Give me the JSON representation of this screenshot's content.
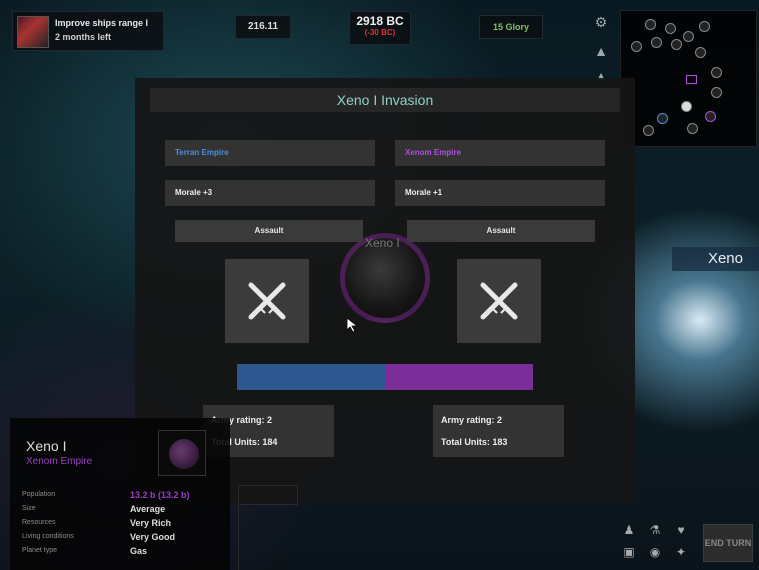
{
  "research": {
    "title": "Improve ships range I",
    "time_left": "2 months left"
  },
  "resources": {
    "credits": "216.11",
    "date": "2918 BC",
    "date_delta": "(-30 BC)",
    "glory": "15 Glory"
  },
  "dialog": {
    "title": "Xeno I Invasion",
    "attacker": {
      "empire": "Terran Empire",
      "morale": "Morale +3",
      "action": "Assault",
      "army_rating": "Army rating: 2",
      "total_units": "Total Units: 184",
      "color": "#4a8fe0"
    },
    "defender": {
      "empire": "Xenom Empire",
      "morale": "Morale +1",
      "action": "Assault",
      "army_rating": "Army rating: 2",
      "total_units": "Total Units: 183",
      "color": "#b04fe0"
    },
    "balance": {
      "attacker_share": 0.5,
      "attacker_color": "#2f5790",
      "defender_color": "#7b2d9a"
    },
    "planet_label_bg": "Xeno I"
  },
  "planet": {
    "name": "Xeno I",
    "owner": "Xenom Empire",
    "rows": [
      {
        "label": "Population",
        "value": "13.2 b (13.2 b)"
      },
      {
        "label": "Size",
        "value": "Average"
      },
      {
        "label": "Resources",
        "value": "Very Rich"
      },
      {
        "label": "Living conditions",
        "value": "Very Good"
      },
      {
        "label": "Planet type",
        "value": "Gas"
      }
    ]
  },
  "map_label": "Xeno",
  "end_turn": "END TURN",
  "icons": [
    "magnify-icon",
    "ship-icon",
    "fleet-icon",
    "research-icon",
    "diplomacy-icon",
    "leaders-icon",
    "planets-icon",
    "galaxy-icon",
    "stats-icon",
    "crossed-rifles-icon"
  ]
}
